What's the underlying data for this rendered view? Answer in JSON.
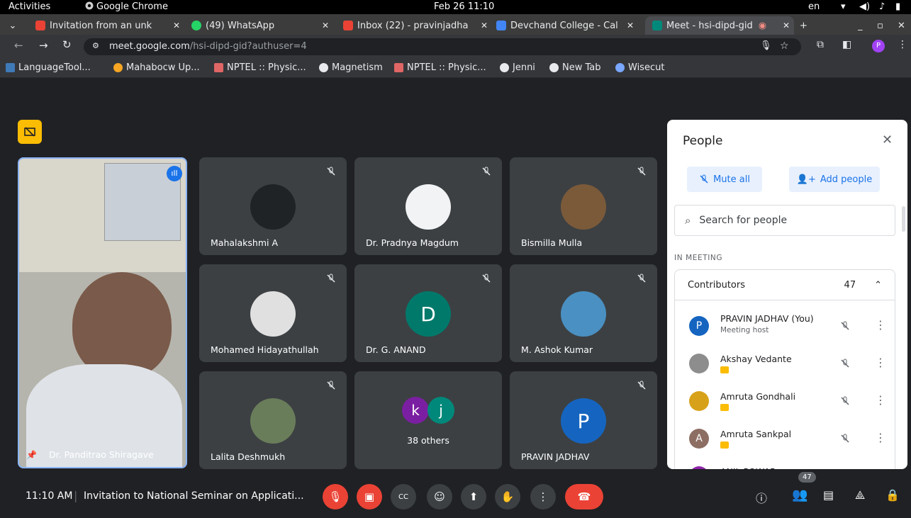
{
  "system_bar": {
    "activities": "Activities",
    "app": "Google Chrome",
    "datetime": "Feb 26  11:10",
    "lang": "en"
  },
  "tabs": [
    {
      "label": "Invitation from an unk",
      "icon": "gmail-icon"
    },
    {
      "label": "(49) WhatsApp",
      "icon": "whatsapp-icon"
    },
    {
      "label": "Inbox (22) - pravinjadha",
      "icon": "gmail-icon"
    },
    {
      "label": "Devchand College - Cal",
      "icon": "calendar-icon"
    },
    {
      "label": "Meet - hsi-dipd-gid",
      "icon": "meet-icon"
    }
  ],
  "address": {
    "host": "meet.google.com",
    "path": "/hsi-dipd-gid?authuser=4"
  },
  "profile_initial": "P",
  "bookmarks": [
    "LanguageTool...",
    "Mahabocw Up...",
    "NPTEL :: Physic...",
    "Magnetism",
    "NPTEL :: Physic...",
    "Jenni",
    "New Tab",
    "Wisecut"
  ],
  "speaker": {
    "name": "Dr. Panditrao Shiragave"
  },
  "tiles": [
    {
      "name": "Mahalakshmi A",
      "initial": "",
      "color": "#1f2326"
    },
    {
      "name": "Dr. Pradnya Magdum",
      "initial": "",
      "color": "#f1f3f4"
    },
    {
      "name": "Bismilla Mulla",
      "initial": "",
      "color": "#7b5a3a"
    },
    {
      "name": "Mohamed Hidayathullah",
      "initial": "",
      "color": "#e0e0e0"
    },
    {
      "name": "Dr. G. ANAND",
      "initial": "D",
      "color": "#00796b"
    },
    {
      "name": "M. Ashok Kumar",
      "initial": "",
      "color": "#4a90c2"
    },
    {
      "name": "Lalita Deshmukh",
      "initial": "",
      "color": "#6a7d5a"
    },
    {
      "name": "38 others",
      "initial": "",
      "color": "#3c4043"
    },
    {
      "name": "PRAVIN JADHAV",
      "initial": "P",
      "color": "#1565c0"
    }
  ],
  "others_initials": [
    "k",
    "j"
  ],
  "people_panel": {
    "title": "People",
    "mute_all": "Mute all",
    "add_people": "Add people",
    "search_placeholder": "Search for people",
    "in_meeting": "IN MEETING",
    "section": "Contributors",
    "count": "47",
    "people": [
      {
        "name": "PRAVIN JADHAV (You)",
        "sub": "Meeting host",
        "initial": "P",
        "color": "#1565c0"
      },
      {
        "name": "Akshay Vedante",
        "sub": "",
        "initial": "",
        "color": "#8d8d8d"
      },
      {
        "name": "Amruta Gondhali",
        "sub": "",
        "initial": "",
        "color": "#d7a21a"
      },
      {
        "name": "Amruta Sankpal",
        "sub": "",
        "initial": "A",
        "color": "#8d6e63"
      },
      {
        "name": "ANIL POWAR",
        "sub": "",
        "initial": "A",
        "color": "#8e24aa"
      }
    ]
  },
  "bottom": {
    "time": "11:10 AM",
    "meeting_title": "Invitation to National Seminar on Applicati...",
    "participants_badge": "47"
  }
}
